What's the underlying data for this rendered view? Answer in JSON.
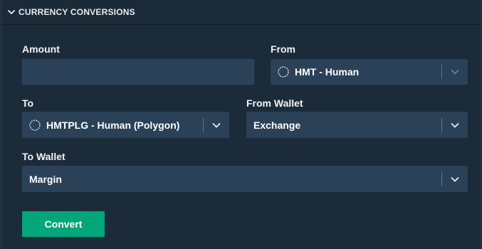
{
  "header": {
    "title": "CURRENCY CONVERSIONS"
  },
  "form": {
    "amount_label": "Amount",
    "amount_value": "",
    "from_label": "From",
    "from_value": "HMT - Human",
    "to_label": "To",
    "to_value": "HMTPLG - Human (Polygon)",
    "from_wallet_label": "From Wallet",
    "from_wallet_value": "Exchange",
    "to_wallet_label": "To Wallet",
    "to_wallet_value": "Margin",
    "convert_label": "Convert"
  },
  "colors": {
    "background": "#1c2b3a",
    "field": "#2a4157",
    "accent": "#03a678"
  },
  "icons": {
    "header": "chevron-down-icon",
    "coin": "coin-outline-icon",
    "dropdown": "chevron-down-icon"
  }
}
